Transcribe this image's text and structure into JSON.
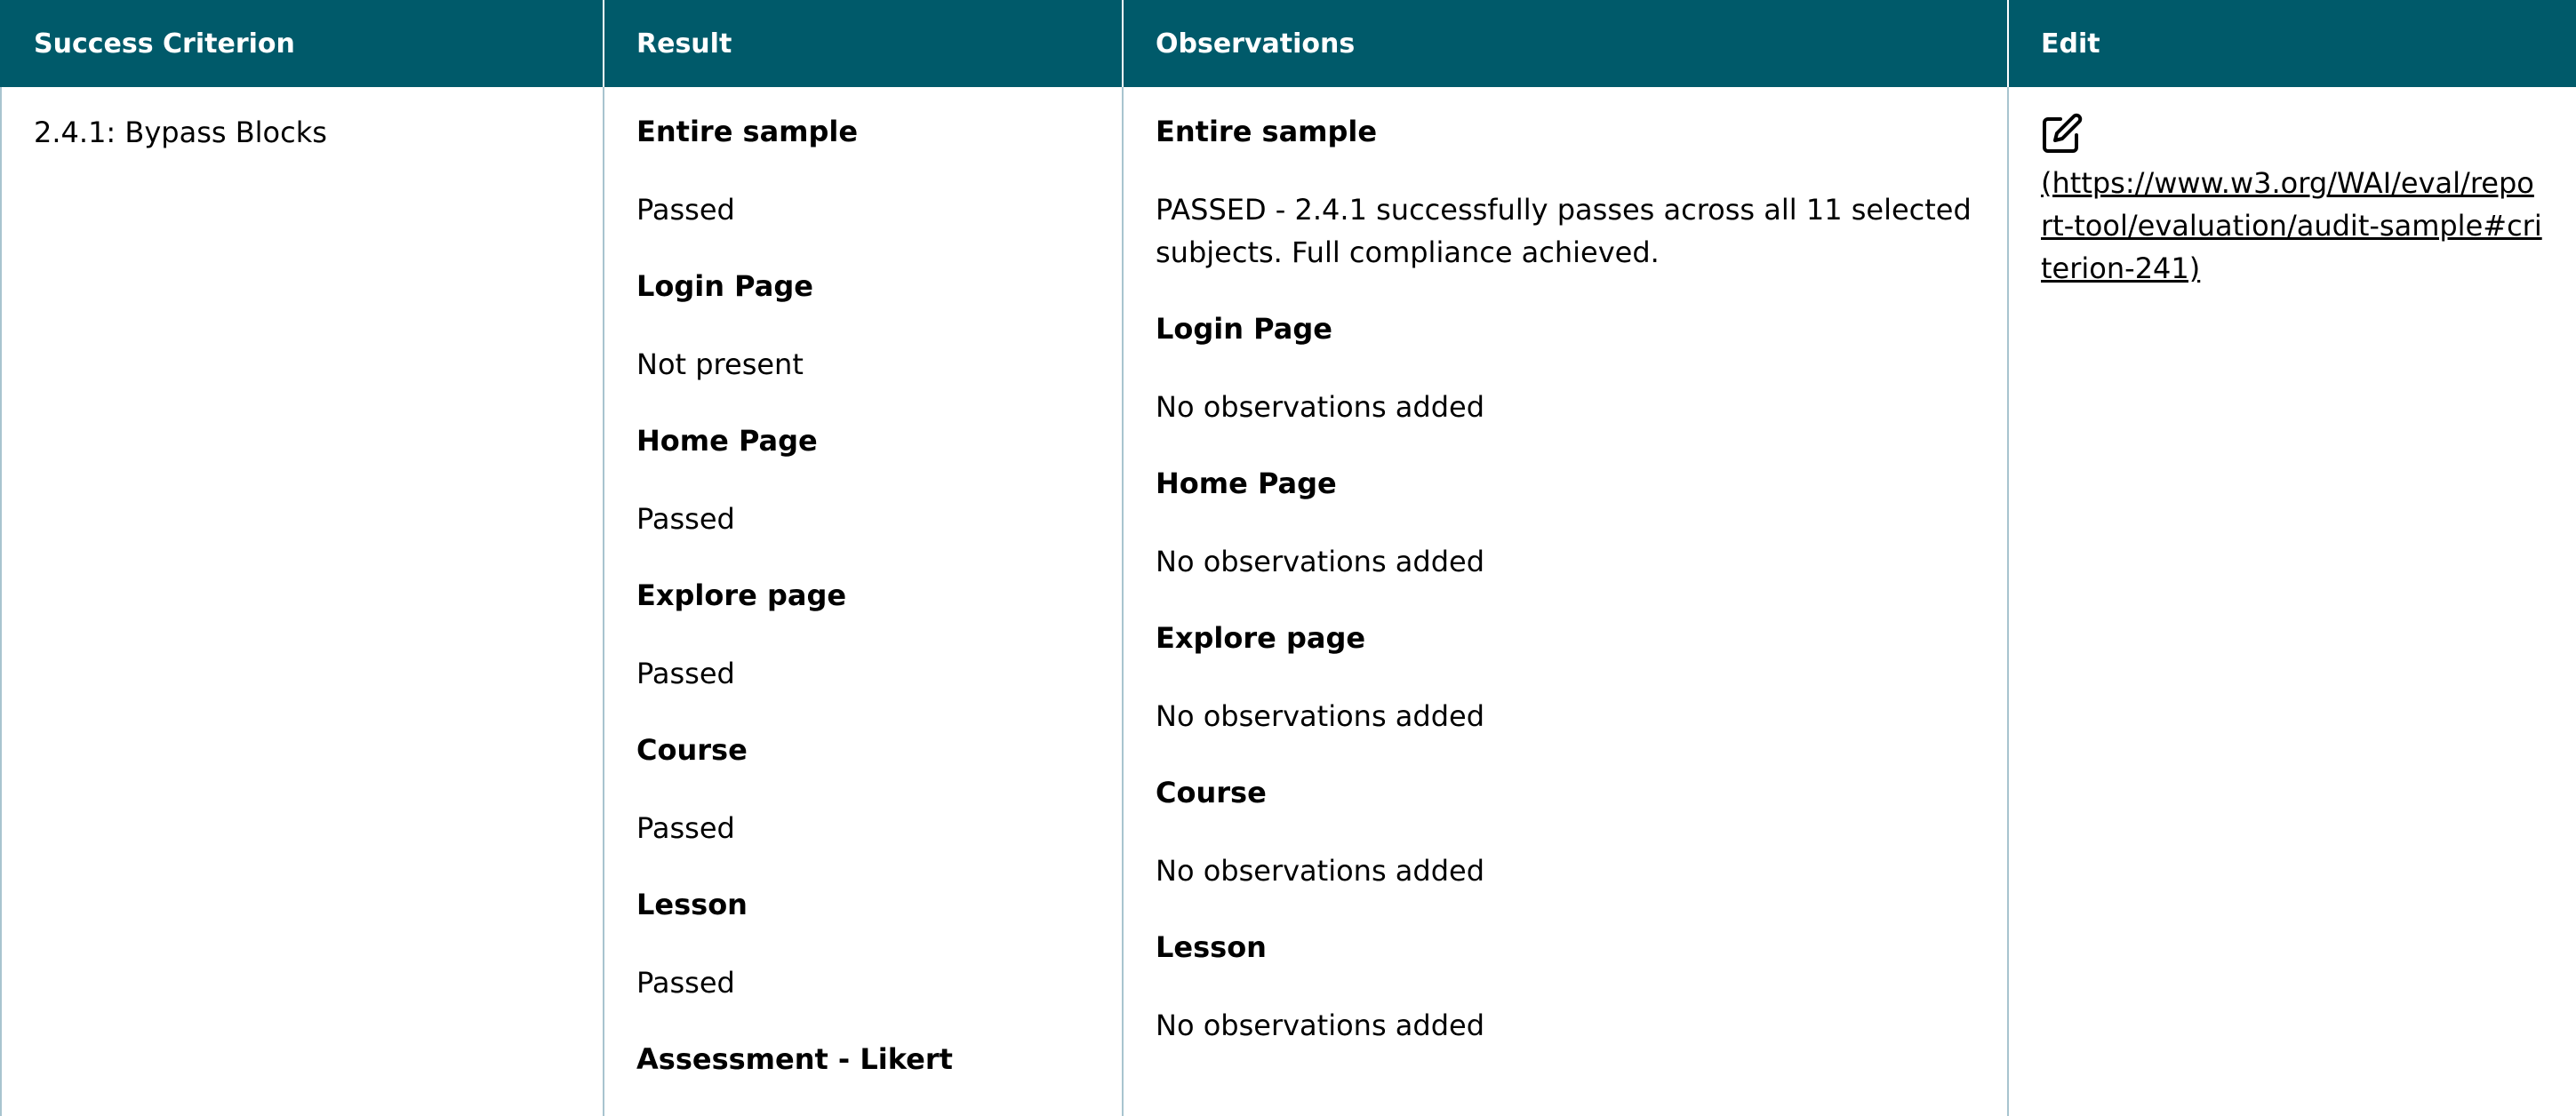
{
  "table": {
    "headers": {
      "criterion": "Success Criterion",
      "result": "Result",
      "observations": "Observations",
      "edit": "Edit"
    },
    "row": {
      "criterion": "2.4.1: Bypass Blocks",
      "results": [
        {
          "title": "Entire sample",
          "value": "Passed"
        },
        {
          "title": "Login Page",
          "value": "Not present"
        },
        {
          "title": "Home Page",
          "value": "Passed"
        },
        {
          "title": "Explore page",
          "value": "Passed"
        },
        {
          "title": "Course",
          "value": "Passed"
        },
        {
          "title": "Lesson",
          "value": "Passed"
        },
        {
          "title": "Assessment - Likert",
          "value": ""
        }
      ],
      "observations": [
        {
          "title": "Entire sample",
          "value": "PASSED - 2.4.1 successfully passes across all 11 selected subjects. Full compliance achieved."
        },
        {
          "title": "Login Page",
          "value": "No observations added"
        },
        {
          "title": "Home Page",
          "value": "No observations added"
        },
        {
          "title": "Explore page",
          "value": "No observations added"
        },
        {
          "title": "Course",
          "value": "No observations added"
        },
        {
          "title": "Lesson",
          "value": "No observations added"
        }
      ],
      "edit": {
        "icon": "edit-icon",
        "link_text": "(https://www.w3.org/WAI/eval/report-tool/evaluation/audit-sample#criterion-241)"
      }
    }
  },
  "colors": {
    "header_bg": "#005a6a",
    "header_text": "#ffffff",
    "border": "#a8c4cf"
  }
}
